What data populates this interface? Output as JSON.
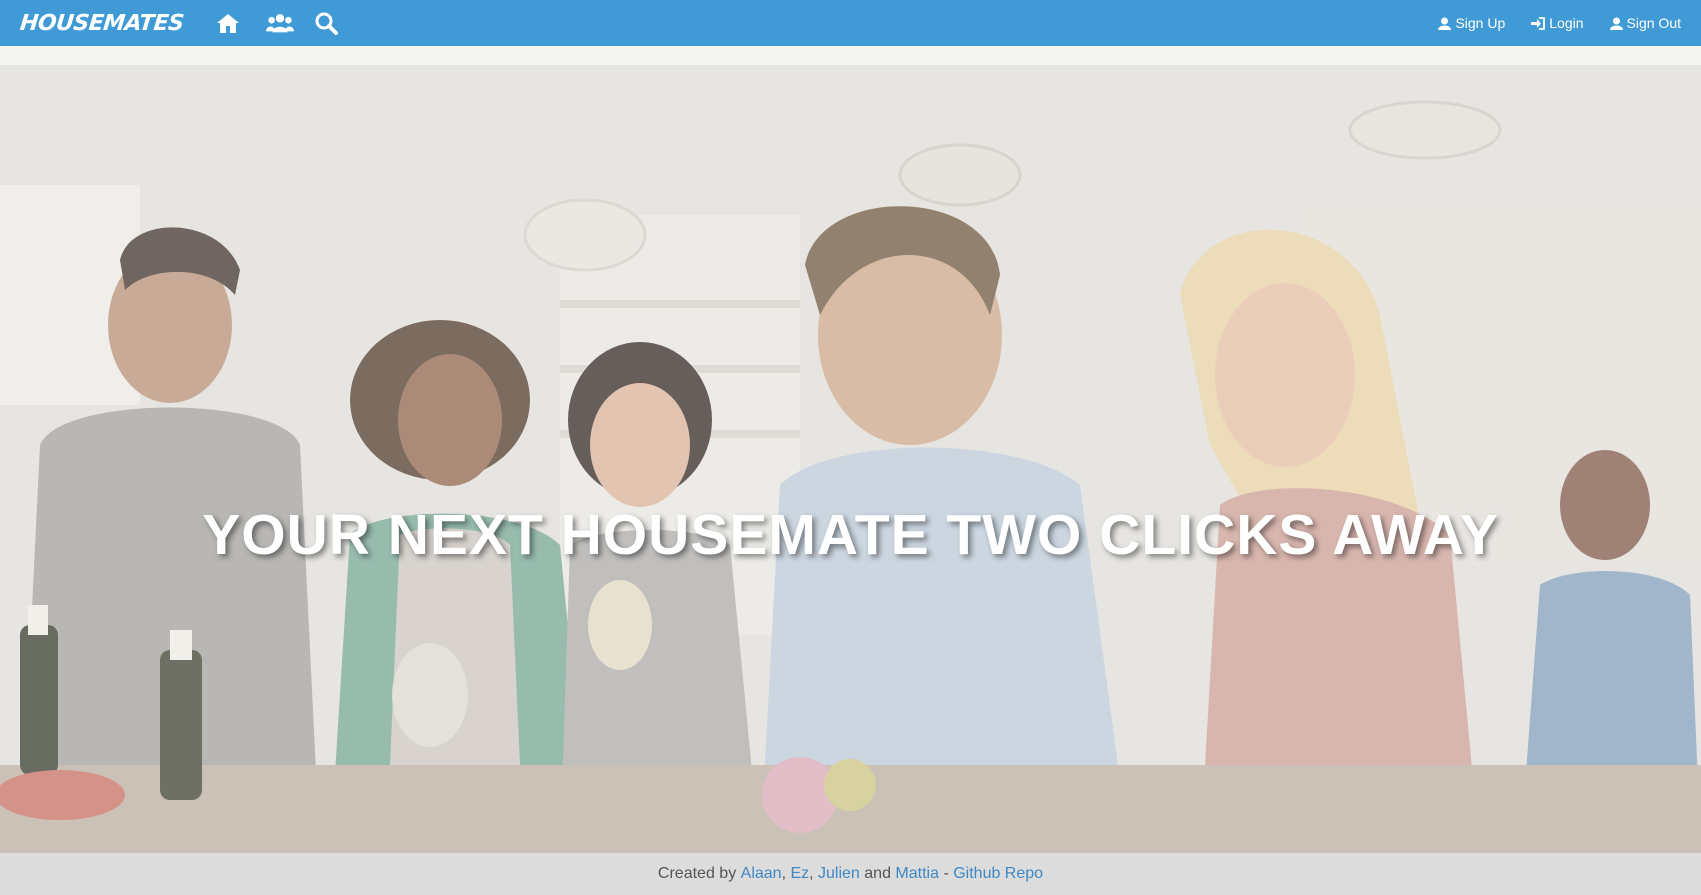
{
  "navbar": {
    "brand": "HOUSEMATES",
    "icons": [
      "home-icon",
      "users-icon",
      "search-icon"
    ],
    "links": [
      {
        "label": "Sign Up",
        "icon": "user-icon"
      },
      {
        "label": "Login",
        "icon": "login-icon"
      },
      {
        "label": "Sign Out",
        "icon": "user-icon"
      }
    ],
    "color": "#3f9ad6"
  },
  "hero": {
    "title": "YOUR NEXT HOUSEMATE TWO CLICKS AWAY"
  },
  "footer": {
    "prefix": "Created by ",
    "authors": [
      "Alaan",
      "Ez",
      "Julien",
      "Mattia"
    ],
    "sep1": ", ",
    "sep2": ", ",
    "and": " and ",
    "dash": " - ",
    "repo_label": "Github Repo",
    "link_color": "#3f88c5"
  }
}
